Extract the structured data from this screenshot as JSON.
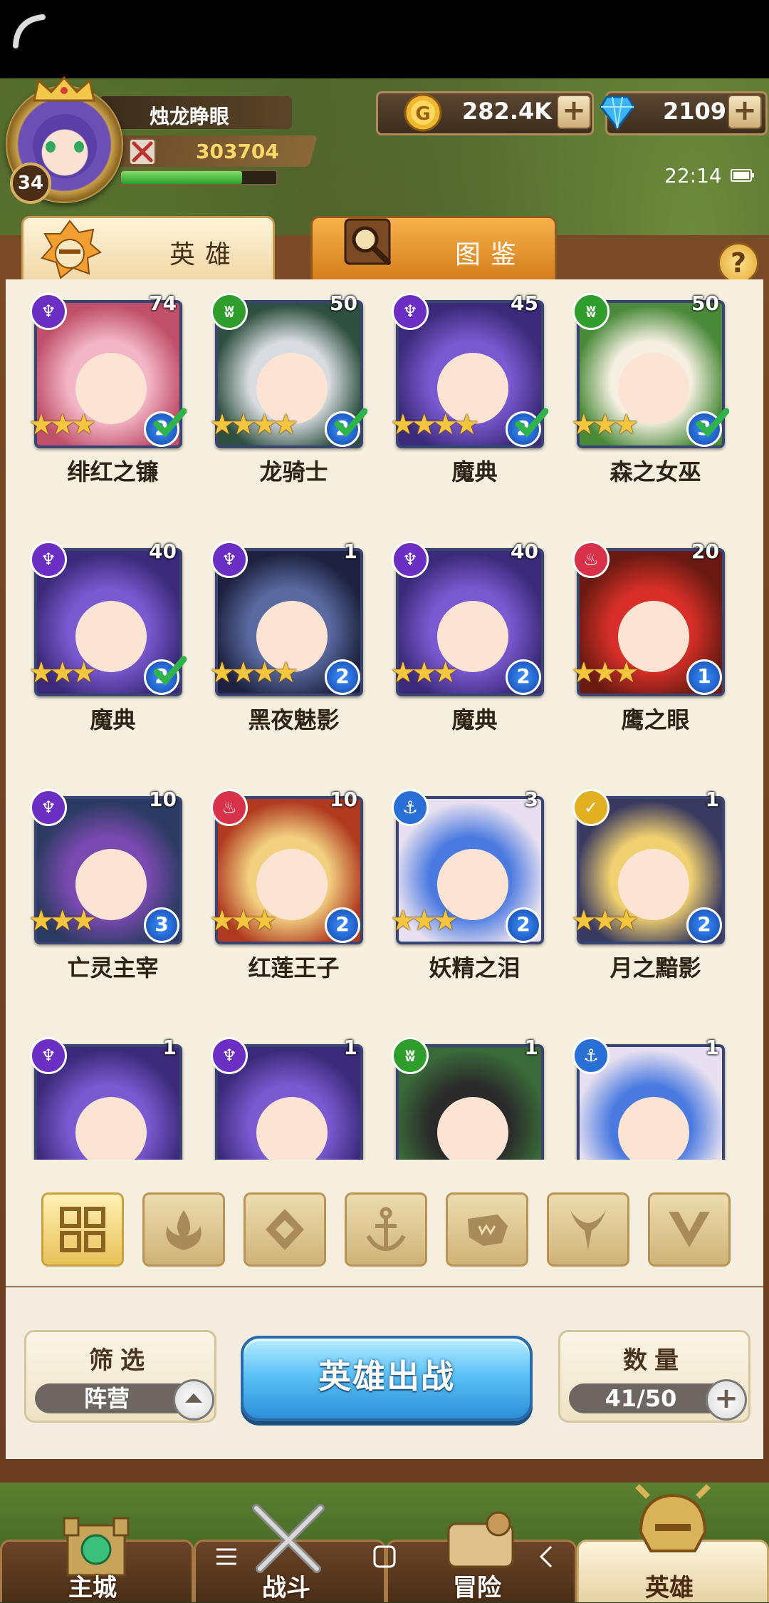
{
  "player": {
    "name": "烛龙睁眼",
    "level": "34",
    "power": "303704",
    "exp_fraction": 0.78
  },
  "currency": {
    "gold": "282.4K",
    "gems": "2109"
  },
  "status": {
    "time": "22:14"
  },
  "tabs": [
    {
      "label": "英雄",
      "active": true
    },
    {
      "label": "图鉴",
      "active": false
    }
  ],
  "help_label": "?",
  "heroes": [
    {
      "name": "绯红之镰",
      "level": "74",
      "faction": "shadow",
      "stars": 3,
      "rank": "2",
      "check": true,
      "palette": [
        "#f3b6c6",
        "#c0506a"
      ]
    },
    {
      "name": "龙骑士",
      "level": "50",
      "faction": "beast",
      "stars": 4,
      "rank": "2",
      "check": true,
      "palette": [
        "#d8dbe0",
        "#2f5040"
      ]
    },
    {
      "name": "魔典",
      "level": "45",
      "faction": "shadow",
      "stars": 4,
      "rank": "2",
      "check": true,
      "palette": [
        "#7a5ad0",
        "#3b2a7a"
      ]
    },
    {
      "name": "森之女巫",
      "level": "50",
      "faction": "beast",
      "stars": 3,
      "rank": "3",
      "check": true,
      "palette": [
        "#f4efe0",
        "#4a8a3a"
      ]
    },
    {
      "name": "魔典",
      "level": "40",
      "faction": "shadow",
      "stars": 3,
      "rank": "2",
      "check": true,
      "palette": [
        "#7a5ad0",
        "#3b2a7a"
      ]
    },
    {
      "name": "黑夜魅影",
      "level": "1",
      "faction": "shadow",
      "stars": 4,
      "rank": "2",
      "check": false,
      "palette": [
        "#5a6aa0",
        "#1e2240"
      ]
    },
    {
      "name": "魔典",
      "level": "40",
      "faction": "shadow",
      "stars": 3,
      "rank": "2",
      "check": false,
      "palette": [
        "#7a5ad0",
        "#3b2a7a"
      ]
    },
    {
      "name": "鹰之眼",
      "level": "20",
      "faction": "fire",
      "stars": 3,
      "rank": "1",
      "check": false,
      "palette": [
        "#d83028",
        "#6a1a12"
      ]
    },
    {
      "name": "亡灵主宰",
      "level": "10",
      "faction": "shadow",
      "stars": 3,
      "rank": "3",
      "check": false,
      "palette": [
        "#7a4ab0",
        "#2a3a60"
      ]
    },
    {
      "name": "红莲王子",
      "level": "10",
      "faction": "fire",
      "stars": 3,
      "rank": "2",
      "check": false,
      "palette": [
        "#f2d080",
        "#b03a20"
      ]
    },
    {
      "name": "妖精之泪",
      "level": "3",
      "faction": "water",
      "stars": 3,
      "rank": "2",
      "check": false,
      "palette": [
        "#4a7ae0",
        "#e8e0f0"
      ]
    },
    {
      "name": "月之黯影",
      "level": "1",
      "faction": "light",
      "stars": 3,
      "rank": "2",
      "check": false,
      "palette": [
        "#f0d070",
        "#3a3a60"
      ]
    },
    {
      "name": "",
      "level": "1",
      "faction": "shadow",
      "stars": 0,
      "rank": "",
      "check": false,
      "palette": [
        "#7a5ad0",
        "#3b2a7a"
      ]
    },
    {
      "name": "",
      "level": "1",
      "faction": "shadow",
      "stars": 0,
      "rank": "",
      "check": false,
      "palette": [
        "#7a5ad0",
        "#3b2a7a"
      ]
    },
    {
      "name": "",
      "level": "1",
      "faction": "beast",
      "stars": 0,
      "rank": "",
      "check": false,
      "palette": [
        "#2a2a2a",
        "#3a6a3a"
      ]
    },
    {
      "name": "",
      "level": "1",
      "faction": "water",
      "stars": 0,
      "rank": "",
      "check": false,
      "palette": [
        "#4a7ae0",
        "#e8e0f0"
      ]
    }
  ],
  "faction_colors": {
    "shadow": "#6b2fc4",
    "beast": "#2f9e2c",
    "fire": "#d8314a",
    "water": "#2a6fd6",
    "light": "#e0b020"
  },
  "filters": [
    {
      "icon": "grid-icon",
      "active": true
    },
    {
      "icon": "fire-faction-icon",
      "active": false
    },
    {
      "icon": "light-faction-icon",
      "active": false
    },
    {
      "icon": "water-faction-icon",
      "active": false
    },
    {
      "icon": "beast-faction-icon",
      "active": false
    },
    {
      "icon": "shadow-faction-icon",
      "active": false
    },
    {
      "icon": "dark-faction-icon",
      "active": false
    }
  ],
  "controls": {
    "filter_title": "筛选",
    "filter_value": "阵营",
    "deploy_label": "英雄出战",
    "count_title": "数量",
    "count_value": "41/50"
  },
  "bottom_nav": [
    {
      "label": "主城",
      "active": false
    },
    {
      "label": "战斗",
      "active": false
    },
    {
      "label": "冒险",
      "active": false
    },
    {
      "label": "英雄",
      "active": true
    }
  ]
}
